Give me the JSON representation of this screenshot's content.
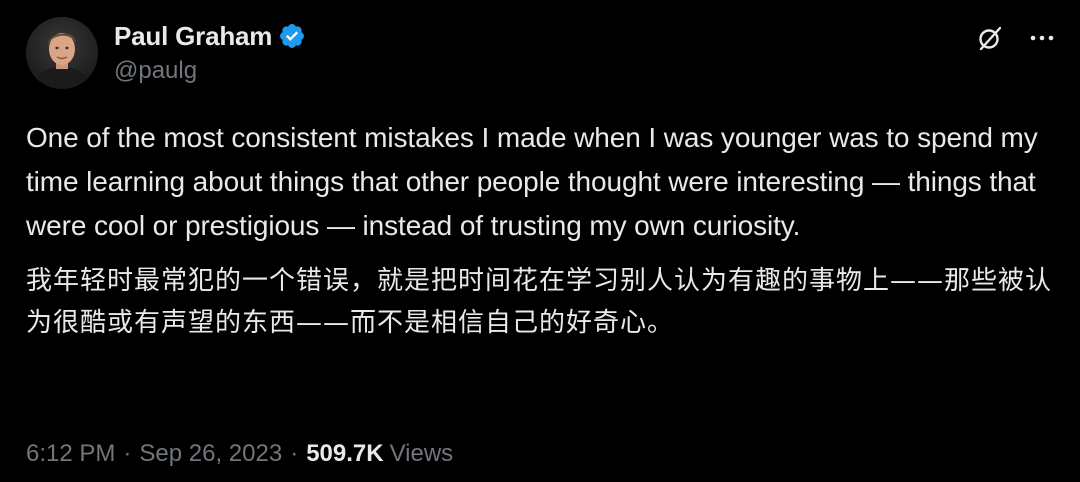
{
  "author": {
    "display_name": "Paul Graham",
    "handle": "@paulg",
    "verified": true,
    "verified_color": "#1d9bf0"
  },
  "header": {
    "grok_icon": "grok-slash-circle-icon",
    "more_icon": "ellipsis-icon"
  },
  "tweet": {
    "text_en": "One of the most consistent mistakes I made when I was younger was to spend my time learning about things that other people thought were interesting — things that were cool or prestigious — instead of trusting my own curiosity.",
    "text_zh": "我年轻时最常犯的一个错误，就是把时间花在学习别人认为有趣的事物上——那些被认为很酷或有声望的东西——而不是相信自己的好奇心。"
  },
  "meta": {
    "time": "6:12 PM",
    "separator": "·",
    "date": "Sep 26, 2023",
    "views_count": "509.7K",
    "views_label": "Views"
  },
  "colors": {
    "background": "#000000",
    "text_primary": "#e7e9ea",
    "text_secondary": "#71767b"
  }
}
